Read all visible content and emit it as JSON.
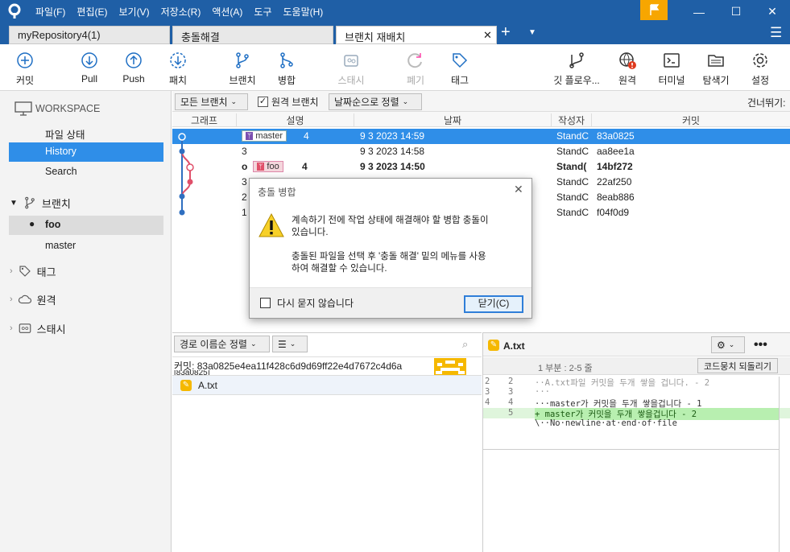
{
  "colors": {
    "titlebar": "#1f5fa6",
    "selection": "#2f8ee8",
    "flag": "#f7a600"
  },
  "menu": [
    "파일(F)",
    "편집(E)",
    "보기(V)",
    "저장소(R)",
    "액션(A)",
    "도구",
    "도움말(H)"
  ],
  "tabs": [
    "myRepository4(1)",
    "충돌해결",
    "브랜치 재배치"
  ],
  "toolbar": {
    "commit": "커밋",
    "pull": "Pull",
    "push": "Push",
    "fetch": "패치",
    "branch": "브랜치",
    "merge": "병합",
    "stash": "스태시",
    "discard": "폐기",
    "tag": "태그",
    "gitflow": "깃 플로우...",
    "remote": "원격",
    "terminal": "터미널",
    "explorer": "탐색기",
    "settings": "설정"
  },
  "sidebar": {
    "workspace": "WORKSPACE",
    "file_status": "파일 상태",
    "history": "History",
    "search": "Search",
    "branches": "브랜치",
    "branch_items": [
      "foo",
      "master"
    ],
    "tags": "태그",
    "remotes": "원격",
    "stashes": "스태시"
  },
  "filters": {
    "all_branches": "모든 브랜치",
    "remote_branches": "원격 브랜치",
    "date_sort": "날짜순으로 정렬",
    "skip": "건너뛰기:"
  },
  "columns": {
    "graph": "그래프",
    "desc": "설명",
    "date": "날짜",
    "author": "작성자",
    "commit": "커밋"
  },
  "commits": [
    {
      "badge": "master",
      "desc": "4",
      "date": "9 3 2023 14:59",
      "author": "StandC",
      "hash": "83a0825"
    },
    {
      "badge": "",
      "desc": "3",
      "date": "9 3 2023 14:58",
      "author": "StandC",
      "hash": "aa8ee1a"
    },
    {
      "badge": "foo",
      "desc": "4",
      "date": "9 3 2023 14:50",
      "author": "Stand(",
      "hash": "14bf272"
    },
    {
      "badge": "",
      "desc": "3",
      "date": "",
      "author": "StandC",
      "hash": "22af250"
    },
    {
      "badge": "",
      "desc": "2",
      "date": "",
      "author": "StandC",
      "hash": "8eab886"
    },
    {
      "badge": "",
      "desc": "1",
      "date": "",
      "author": "StandC",
      "hash": "f04f0d9"
    }
  ],
  "dialog": {
    "title": "충돌 병합",
    "line1": "계속하기 전에 작업 상태에 해결해야 할 병합 충돌이",
    "line2": "있습니다.",
    "line3": "충돌된 파일을 선택 후 '충돌 해결' 밑의 메뉴를 사용",
    "line4": "하여 해결할 수 있습니다.",
    "dont_ask": "다시 묻지 않습니다",
    "close": "닫기(C)"
  },
  "lower": {
    "path_sort": "경로 이름순 정렬",
    "commit_label": "커밋: 83a0825e4ea11f428c6d9d69ff22e4d7672c4d6a",
    "commit_tail": "[83a0825]",
    "file": "A.txt",
    "diff_file": "A.txt",
    "hunk": "1 부분 : 2-5 줄",
    "revert": "코드뭉치 되돌리기",
    "diff_lines": [
      {
        "old": "2",
        "new": "2",
        "text": "··A.txt파일 커밋을 두개 쌓을 겁니다. - 2",
        "kind": "ctx"
      },
      {
        "old": "3",
        "new": "3",
        "text": "···",
        "kind": "ctx"
      },
      {
        "old": "4",
        "new": "4",
        "text": "···master가 커밋을 두개 쌓을겁니다 - 1",
        "kind": "ctx"
      },
      {
        "old": "",
        "new": "5",
        "text": "+ master가 커밋을 두개 쌓을겁니다 - 2",
        "kind": "add"
      },
      {
        "old": "",
        "new": "",
        "text": "\\··No·newline·at·end·of·file",
        "kind": "ctx"
      }
    ]
  }
}
